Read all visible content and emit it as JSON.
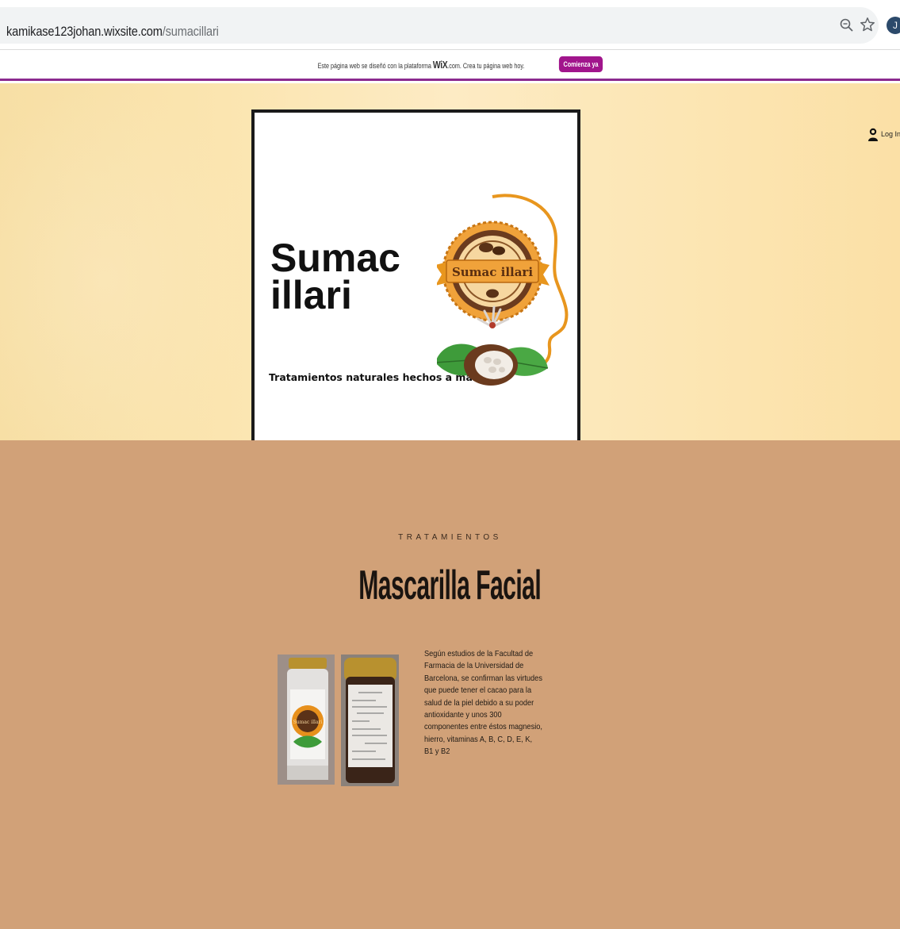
{
  "browser": {
    "url_host": "kamikase123johan.wixsite.com",
    "url_path": "/sumacillari",
    "profile_initial": "J"
  },
  "wix_banner": {
    "text_before": "Este página web se diseñó con la plataforma",
    "logo": "WiX",
    "text_after": ".com. Crea tu página web hoy.",
    "cta_label": "Comienza ya"
  },
  "hero": {
    "login_label": "Log In",
    "brand_line1": "Sumac",
    "brand_line2": "illari",
    "tagline": "Tratamientos naturales hechos a mano",
    "emblem_text": "Sumac illari"
  },
  "treatments": {
    "kicker": "TRATAMIENTOS",
    "title": "Mascarilla Facial",
    "front_label_text": "Sumac illari",
    "description": "Según estudios de la Facultad de Farmacia de la Universidad de Barcelona, se confirman las virtudes que puede tener el cacao para la salud de la piel debido a su poder antioxidante y  unos 300 componentes entre éstos magnesio, hierro, vitaminas A, B, C, D, E, K, B1 y  B2"
  },
  "colors": {
    "wix_purple": "#8b2a8f",
    "cta_magenta": "#a1158c",
    "section_tan": "#d1a178",
    "hero_cream": "#fbe5b0",
    "emblem_orange": "#e8961e"
  }
}
